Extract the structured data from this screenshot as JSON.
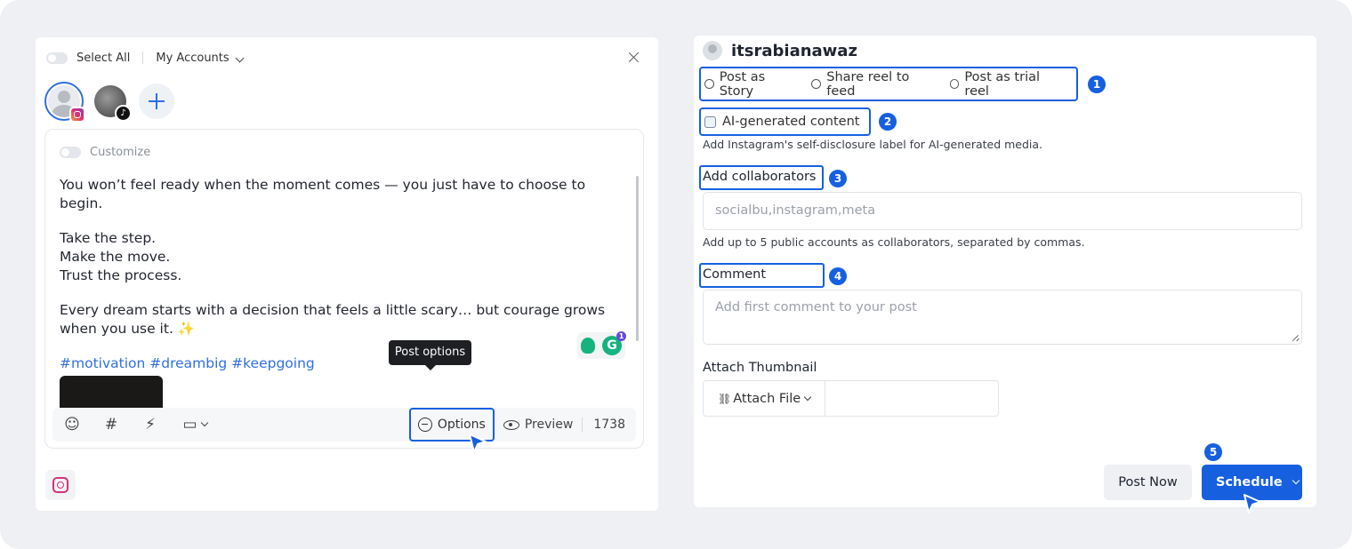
{
  "left": {
    "select_all": "Select All",
    "my_accounts": "My Accounts",
    "customize": "Customize",
    "post": {
      "line1": "You won’t feel ready when the moment comes — you just have to choose to begin.",
      "line2": "Take the step.",
      "line3": "Make the move.",
      "line4": "Trust the process.",
      "line5": "Every dream starts with a decision that feels a little scary… but courage grows when you use it. ✨",
      "hashtags": "#motivation #dreambig #keepgoing"
    },
    "grammarly": {
      "logo": "G",
      "count": "1"
    },
    "tiktok_glyph": "♪",
    "tooltip": "Post options",
    "toolbar": {
      "emoji_icon": "☺",
      "hashtag_icon": "#",
      "magic_icon": "⚡",
      "image_icon": "▭",
      "options": "Options",
      "preview": "Preview",
      "char_count": "1738"
    }
  },
  "right": {
    "username": "itsrabianawaz",
    "post_types": [
      "Post as Story",
      "Share reel to feed",
      "Post as trial reel"
    ],
    "ai_label": "AI-generated content",
    "ai_help": "Add Instagram's self-disclosure label for AI-generated media.",
    "collab_label": "Add collaborators",
    "collab_placeholder": "socialbu,instagram,meta",
    "collab_help": "Add up to 5 public accounts as collaborators, separated by commas.",
    "comment_label": "Comment",
    "comment_placeholder": "Add first comment to your post",
    "thumb_label": "Attach Thumbnail",
    "attach_file": "Attach File",
    "post_now": "Post Now",
    "schedule": "Schedule",
    "attach_icon": "⛓"
  },
  "steps": [
    "1",
    "2",
    "3",
    "4",
    "5"
  ],
  "colors": {
    "accent": "#1660e0",
    "link": "#2f6fe4",
    "frame_bg": "#eef0f3"
  }
}
